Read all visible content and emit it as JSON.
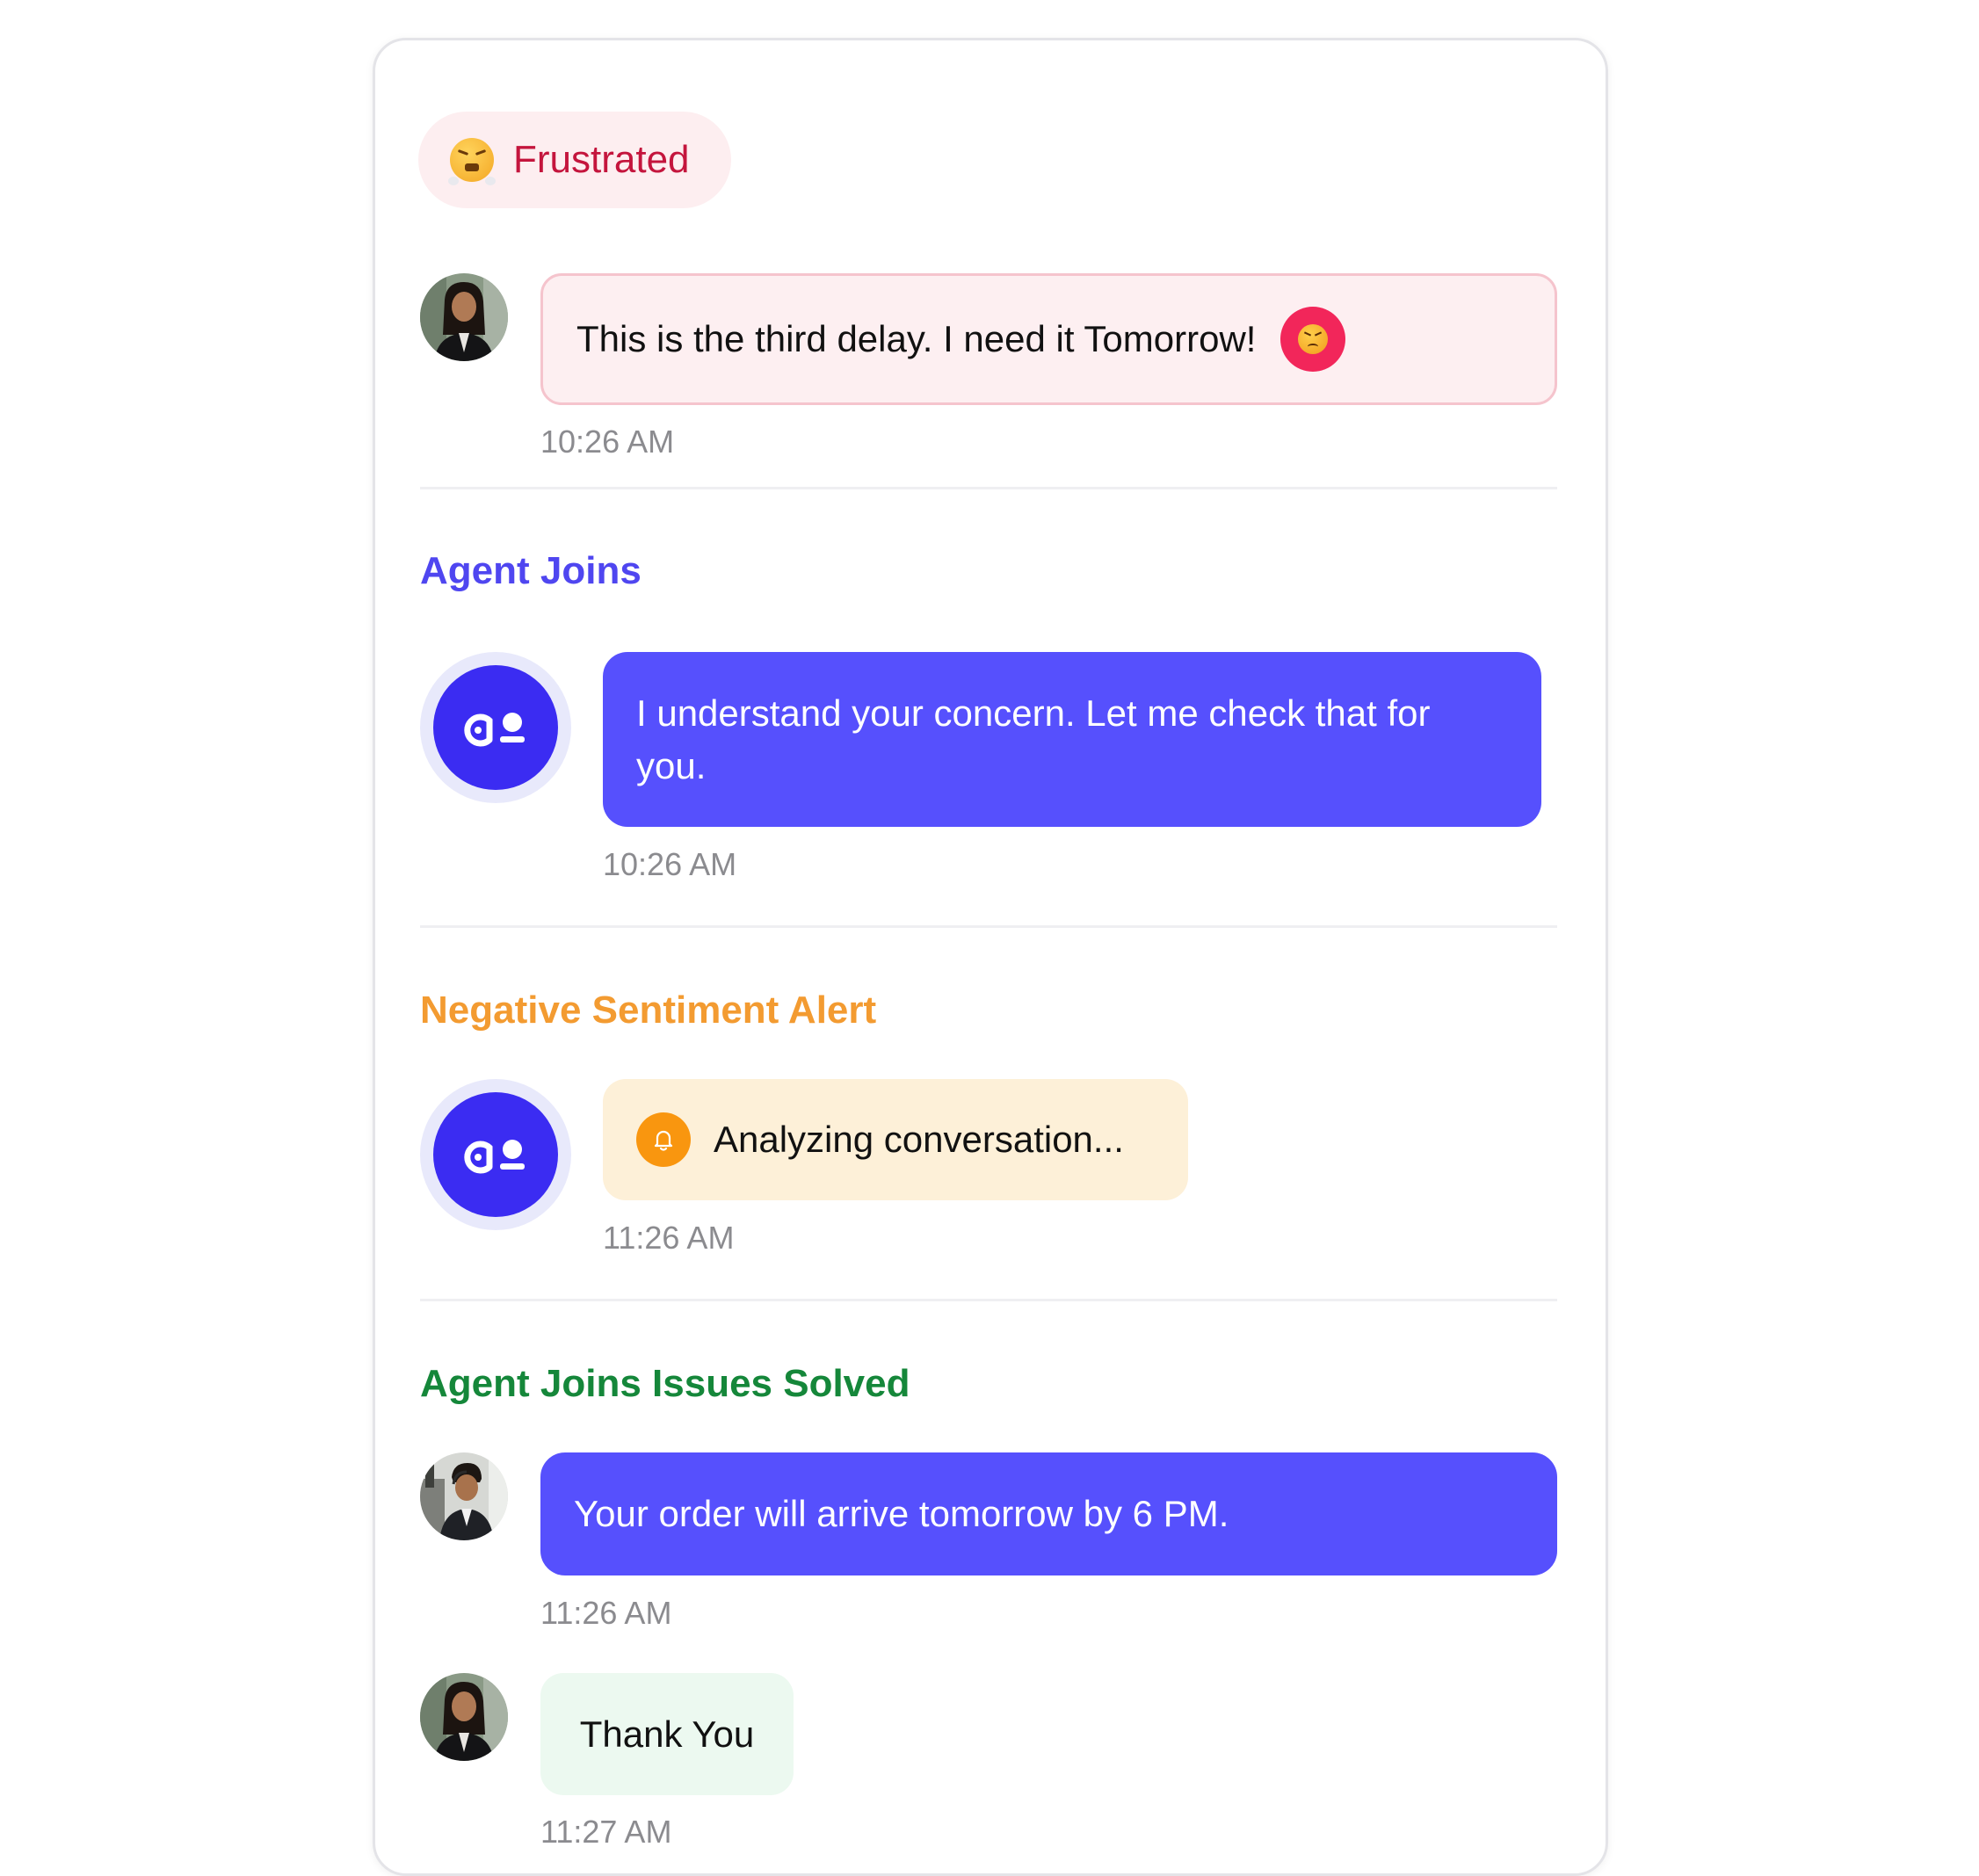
{
  "colors": {
    "mood_text": "#c4153d",
    "mood_bg": "#fdeef0",
    "agent_joins": "#4f46f0",
    "negative_alert": "#f39b31",
    "issues_solved": "#15873a",
    "agent_bubble": "#5650fd",
    "bot_avatar": "#3b2cf2"
  },
  "mood": {
    "label": "Frustrated",
    "icon": "steam-face-emoji-icon"
  },
  "messages": [
    {
      "text": "This is the third delay. I need it Tomorrow!",
      "time": "10:26 AM",
      "sender": "customer",
      "icon": "angry-face-icon"
    },
    {
      "text": "I understand your concern. Let me check that for you.",
      "time": "10:26 AM",
      "sender": "bot"
    },
    {
      "text": "Analyzing conversation...",
      "time": "11:26 AM",
      "sender": "bot",
      "icon": "bell-icon"
    },
    {
      "text": "Your order will arrive tomorrow by 6 PM.",
      "time": "11:26 AM",
      "sender": "agent"
    },
    {
      "text": "Thank You",
      "time": "11:27 AM",
      "sender": "customer"
    }
  ],
  "sections": {
    "agent_joins": "Agent Joins",
    "negative_alert": "Negative Sentiment Alert",
    "issues_solved": "Agent Joins Issues Solved"
  }
}
